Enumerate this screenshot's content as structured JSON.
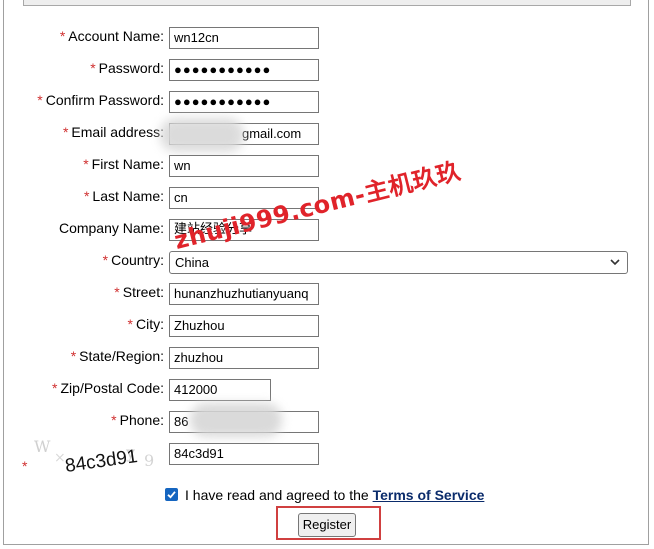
{
  "form": {
    "account_name": {
      "label": "Account Name:",
      "value": "wn12cn"
    },
    "password": {
      "label": "Password:",
      "value": "●●●●●●●●●●●"
    },
    "confirm_password": {
      "label": "Confirm Password:",
      "value": "●●●●●●●●●●●"
    },
    "email": {
      "label": "Email address:",
      "value": "gmail.com"
    },
    "first_name": {
      "label": "First Name:",
      "value": "wn"
    },
    "last_name": {
      "label": "Last Name:",
      "value": "cn"
    },
    "company": {
      "label": "Company Name:",
      "value": "建站经验分享"
    },
    "country": {
      "label": "Country:",
      "value": "China"
    },
    "street": {
      "label": "Street:",
      "value": "hunanzhuzhutianyuanq"
    },
    "city": {
      "label": "City:",
      "value": "Zhuzhou"
    },
    "state": {
      "label": "State/Region:",
      "value": "zhuzhou"
    },
    "zip": {
      "label": "Zip/Postal Code:",
      "value": "412000"
    },
    "phone": {
      "label": "Phone:",
      "value": "86"
    },
    "captcha": {
      "image_text": "84c3d91",
      "value": "84c3d91"
    },
    "required_mark": "*"
  },
  "agree": {
    "text": "I have read and agreed to the",
    "link": "Terms of Service",
    "checked": true
  },
  "register_label": "Register",
  "watermark": "zhuji999.com-主机玖玖",
  "colors": {
    "required": "#d03030",
    "checkbox": "#1565c0",
    "highlight_box": "#d04040",
    "watermark": "#e0232a",
    "link": "#0a2b6b"
  }
}
